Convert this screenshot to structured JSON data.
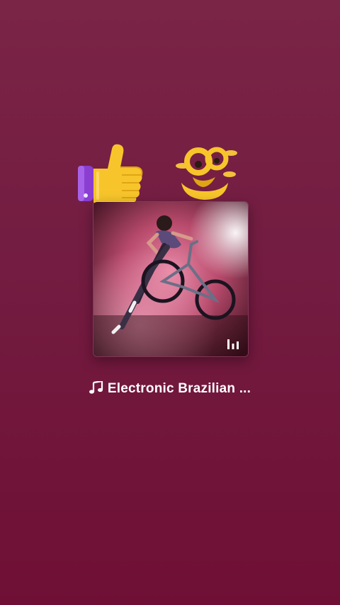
{
  "stickers": {
    "left": "thumbs-up-icon",
    "right": "eyes-face-icon"
  },
  "player": {
    "cover_art": "bmx-rider-in-pink-smoke",
    "playing_indicator": "equalizer-icon",
    "track_icon": "music-note-icon",
    "track_title": "Electronic Brazilian ..."
  },
  "colors": {
    "background_top": "#7a2446",
    "background_bottom": "#6f0f35",
    "text": "#ffffff",
    "accent_yellow": "#f7c52b",
    "accent_purple": "#8a3fd1"
  }
}
